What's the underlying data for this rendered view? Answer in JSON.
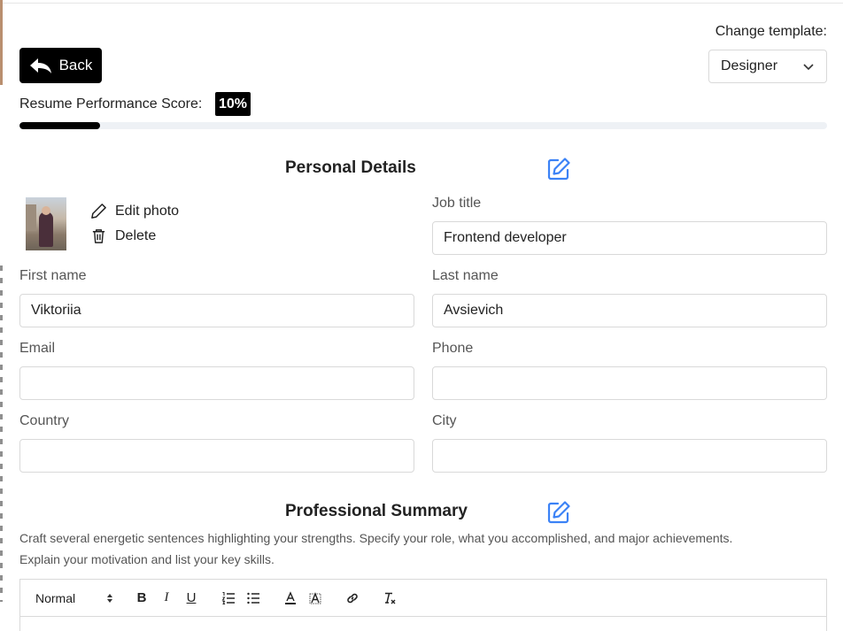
{
  "header": {
    "back_label": "Back",
    "change_template_label": "Change template:",
    "template_value": "Designer"
  },
  "score": {
    "label": "Resume Performance Score:",
    "value_text": "10%",
    "progress_fraction": 0.1
  },
  "personal": {
    "title": "Personal Details",
    "edit_photo_label": "Edit photo",
    "delete_label": "Delete",
    "job_title_label": "Job title",
    "job_title_value": "Frontend developer",
    "first_name_label": "First name",
    "first_name_value": "Viktoriia",
    "last_name_label": "Last name",
    "last_name_value": "Avsievich",
    "email_label": "Email",
    "email_value": "",
    "phone_label": "Phone",
    "phone_value": "",
    "country_label": "Country",
    "country_value": "",
    "city_label": "City",
    "city_value": ""
  },
  "summary": {
    "title": "Professional Summary",
    "description_line1": "Craft several energetic sentences highlighting your strengths. Specify your role, what you accomplished, and major achievements.",
    "description_line2": "Explain your motivation and list your key skills."
  },
  "editor_toolbar": {
    "format_value": "Normal",
    "bold": "B",
    "italic": "I",
    "underline": "U"
  },
  "colors": {
    "accent_blue": "#3b82f6",
    "black": "#000000",
    "progress_track": "#eef1f5"
  }
}
